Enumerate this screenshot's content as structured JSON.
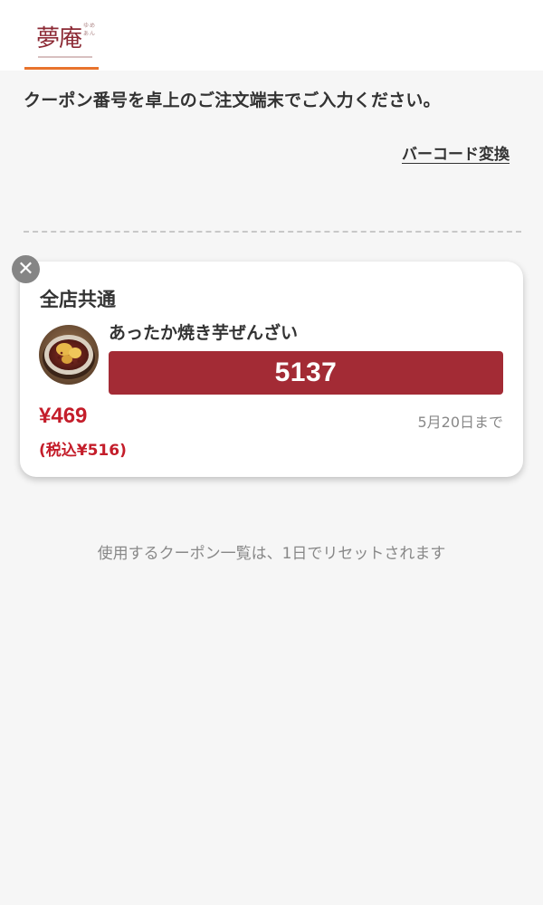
{
  "header": {
    "logo_main": "夢庵",
    "logo_sub": "ゆめあん"
  },
  "instruction_text": "クーポン番号を卓上のご注文端末でご入力ください。",
  "barcode_link": "バーコード変換",
  "coupon": {
    "store_label": "全店共通",
    "product_name": "あったか焼き芋ぜんざい",
    "code": "5137",
    "price": "¥469",
    "price_tax": "(税込¥516)",
    "expiry": "5月20日まで",
    "close_symbol": "✕"
  },
  "reset_note": "使用するクーポン一覧は、1日でリセットされます",
  "colors": {
    "accent_orange": "#e8732c",
    "code_bg": "#a32b35",
    "price_red": "#c41d2a",
    "brand_maroon": "#8c2a35"
  },
  "icons": {
    "close": "close-icon"
  }
}
